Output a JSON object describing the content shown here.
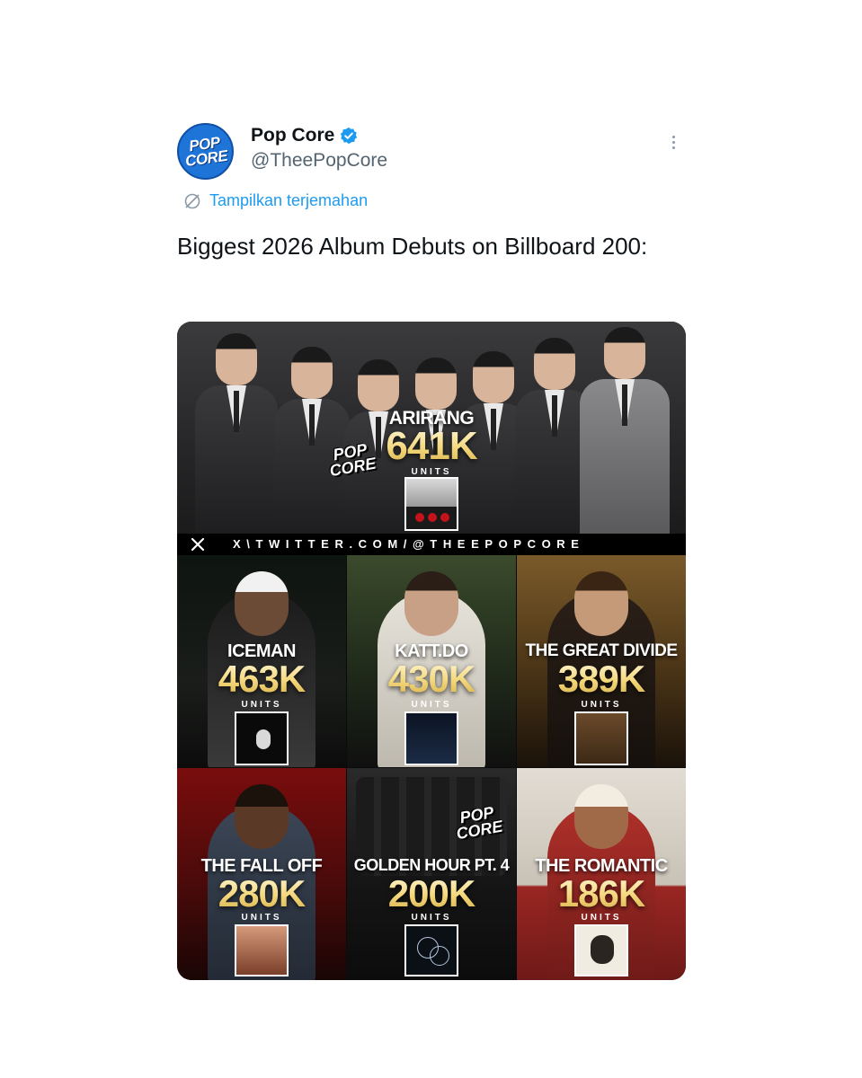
{
  "header": {
    "avatar_text": "POP\nCORE",
    "display_name": "Pop Core",
    "handle": "@TheePopCore"
  },
  "translate_label": "Tampilkan terjemahan",
  "tweet_text": "Biggest 2026 Album Debuts on Billboard 200:",
  "media": {
    "watermark": "POP\nCORE",
    "units_label": "UNITS",
    "banner": "X\\TWITTER.COM/@THEEPOPCORE",
    "feature": {
      "title": "ARIRANG",
      "units": "641K"
    },
    "cells": [
      {
        "title": "ICEMAN",
        "units": "463K"
      },
      {
        "title": "KATT.DO",
        "units": "430K"
      },
      {
        "title": "THE GREAT DIVIDE",
        "units": "389K"
      },
      {
        "title": "THE FALL OFF",
        "units": "280K"
      },
      {
        "title": "GOLDEN HOUR PT. 4",
        "units": "200K"
      },
      {
        "title": "THE ROMANTIC",
        "units": "186K"
      }
    ]
  },
  "colors": {
    "link": "#1d9bf0",
    "verified": "#1d9bf0",
    "units_gold": "#f3d77a"
  },
  "icons": [
    "verified-badge-icon",
    "more-options-icon",
    "translate-globe-icon",
    "x-logo-icon"
  ]
}
